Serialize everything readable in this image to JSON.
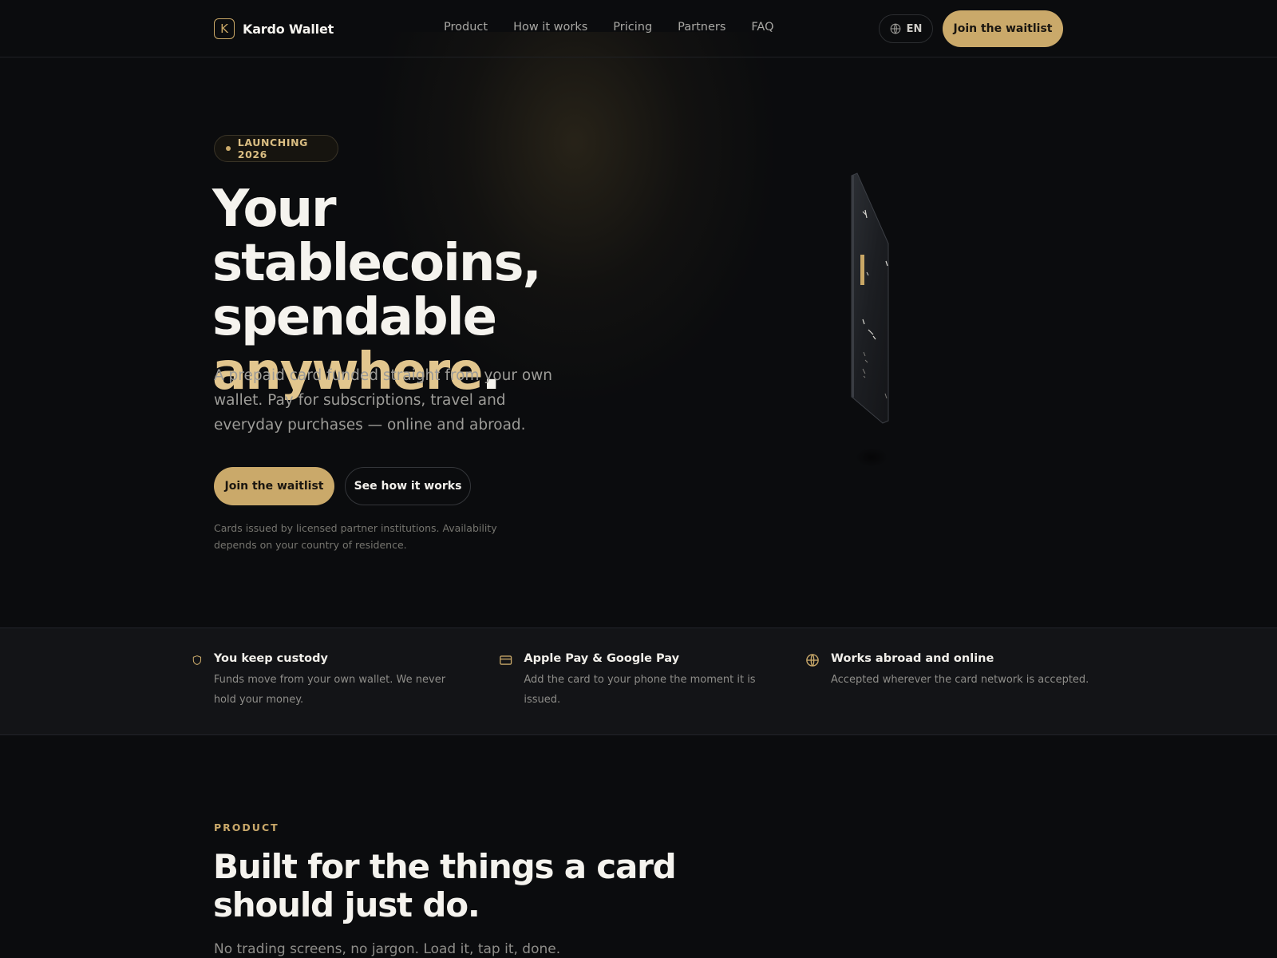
{
  "brand": {
    "name": "Kardo Wallet",
    "logo_letter": "K"
  },
  "nav": {
    "items": [
      "Product",
      "How it works",
      "Pricing",
      "Partners",
      "FAQ"
    ]
  },
  "header": {
    "language": "EN",
    "cta_label": "Join the waitlist"
  },
  "hero": {
    "badge": "LAUNCHING 2026",
    "title_line1": "Your stablecoins,",
    "title_line2": "spendable",
    "title_accent": "anywhere",
    "title_period": ".",
    "subtitle": "A prepaid card funded straight from your own wallet. Pay for subscriptions, travel and everyday purchases — online and abroad.",
    "primary_cta": "Join the waitlist",
    "secondary_cta": "See how it works",
    "disclaimer": "Cards issued by licensed partner institutions. Availability depends on your country of residence."
  },
  "features": [
    {
      "icon": "shield-icon",
      "title": "You keep custody",
      "text": "Funds move from your own wallet. We never hold your money."
    },
    {
      "icon": "card-icon",
      "title": "Apple Pay & Google Pay",
      "text": "Add the card to your phone the moment it is issued."
    },
    {
      "icon": "globe-icon",
      "title": "Works abroad and online",
      "text": "Accepted wherever the card network is accepted."
    }
  ],
  "product": {
    "eyebrow": "PRODUCT",
    "title": "Built for the things a card should just do.",
    "subtitle": "No trading screens, no jargon. Load it, tap it, done."
  },
  "colors": {
    "background": "#0b0c0e",
    "accent_gold": "#caa96a",
    "accent_text": "#e2c68e",
    "band": "#131417"
  }
}
